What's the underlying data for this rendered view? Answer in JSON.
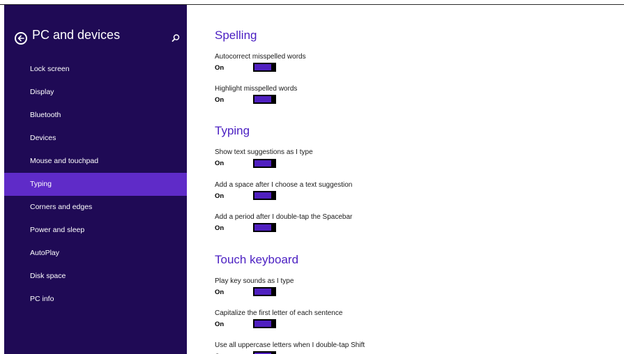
{
  "colors": {
    "sidebar_bg": "#1f0a55",
    "sidebar_active": "#5f2bc8",
    "accent": "#4a1ec2",
    "toggle_fill": "#5020c0"
  },
  "sidebar": {
    "back_icon": "back-arrow-circle-icon",
    "title": "PC and devices",
    "search_icon": "search-icon",
    "items": [
      {
        "label": "Lock screen"
      },
      {
        "label": "Display"
      },
      {
        "label": "Bluetooth"
      },
      {
        "label": "Devices"
      },
      {
        "label": "Mouse and touchpad"
      },
      {
        "label": "Typing",
        "active": true
      },
      {
        "label": "Corners and edges"
      },
      {
        "label": "Power and sleep"
      },
      {
        "label": "AutoPlay"
      },
      {
        "label": "Disk space"
      },
      {
        "label": "PC info"
      }
    ]
  },
  "sections": {
    "spelling": {
      "title": "Spelling",
      "settings": [
        {
          "label": "Autocorrect misspelled words",
          "state": "On",
          "on": true
        },
        {
          "label": "Highlight misspelled words",
          "state": "On",
          "on": true
        }
      ]
    },
    "typing": {
      "title": "Typing",
      "settings": [
        {
          "label": "Show text suggestions as I type",
          "state": "On",
          "on": true
        },
        {
          "label": "Add a space after I choose a text suggestion",
          "state": "On",
          "on": true
        },
        {
          "label": "Add a period after I double-tap the Spacebar",
          "state": "On",
          "on": true
        }
      ]
    },
    "touch_keyboard": {
      "title": "Touch keyboard",
      "settings": [
        {
          "label": "Play key sounds as I type",
          "state": "On",
          "on": true
        },
        {
          "label": "Capitalize the first letter of each sentence",
          "state": "On",
          "on": true
        },
        {
          "label": "Use all uppercase letters when I double-tap Shift",
          "state": "On",
          "on": true
        }
      ]
    }
  }
}
